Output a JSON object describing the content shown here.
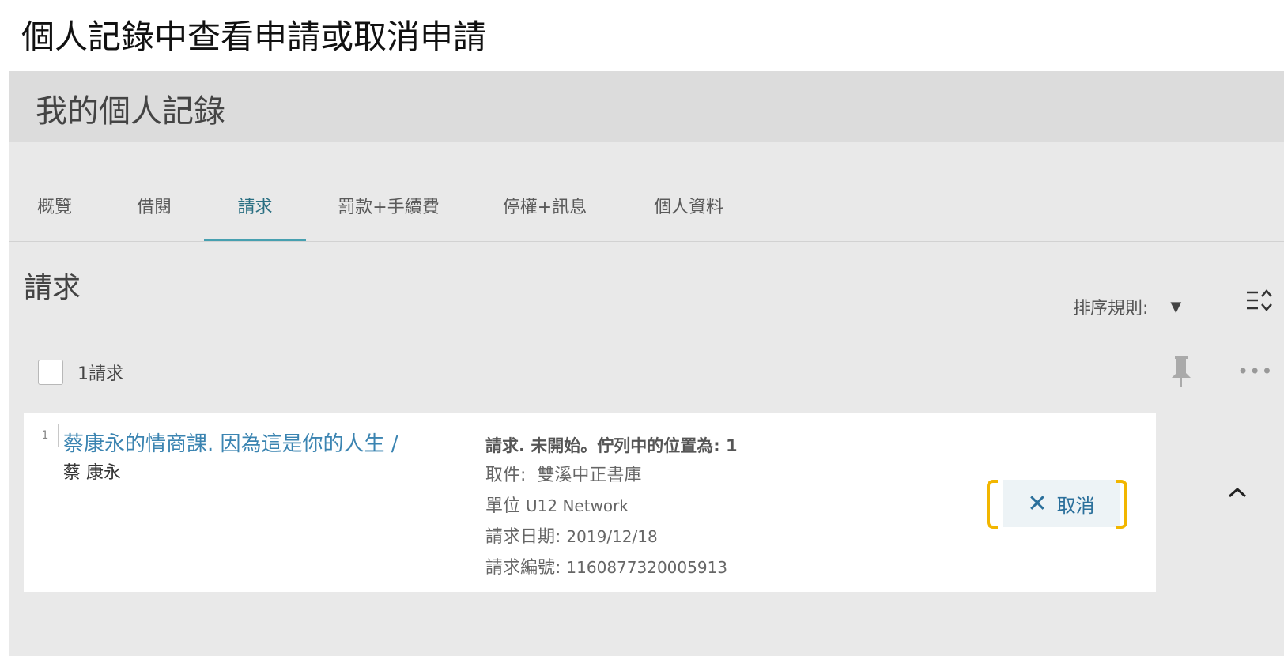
{
  "slide": {
    "title": "個人記錄中查看申請或取消申請"
  },
  "header": {
    "title": "我的個人記錄"
  },
  "tabs": [
    {
      "label": "概覽"
    },
    {
      "label": "借閱"
    },
    {
      "label": "請求",
      "active": true
    },
    {
      "label": "罰款+手續費"
    },
    {
      "label": "停權+訊息"
    },
    {
      "label": "個人資料"
    }
  ],
  "section": {
    "title": "請求",
    "sort_label": "排序規則:",
    "select_all_count": "1請求"
  },
  "request": {
    "index": "1",
    "title": "蔡康永的情商課. 因為這是你的人生 /",
    "author": "蔡 康永",
    "status": "請求. 未開始。佇列中的位置為: 1",
    "pickup_label": "取件:",
    "pickup_value": "雙溪中正書庫",
    "unit_label": "單位",
    "unit_value": "U12 Network",
    "date_label": "請求日期:",
    "date_value": "2019/12/18",
    "id_label": "請求編號:",
    "id_value": "1160877320005913",
    "cancel_label": "取消"
  },
  "colors": {
    "accent": "#47a0b0",
    "link": "#3b84b1",
    "highlight": "#f2b600",
    "panel_bg": "#e9e9e9"
  },
  "icons": [
    "sort-order-icon",
    "pin-icon",
    "more-icon",
    "close-icon",
    "chevron-up-icon",
    "dropdown-caret-icon"
  ]
}
